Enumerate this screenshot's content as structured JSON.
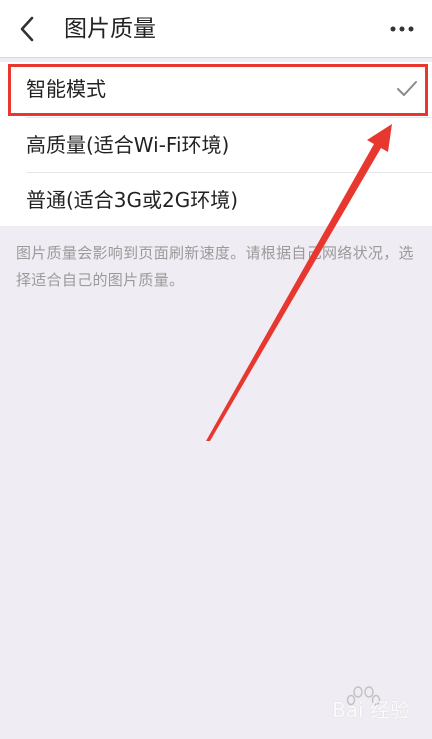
{
  "header": {
    "title": "图片质量",
    "back_icon": "chevron-left-icon",
    "more_icon": "more-dots-icon"
  },
  "options": [
    {
      "label": "智能模式",
      "selected": true
    },
    {
      "label": "高质量(适合Wi-Fi环境)",
      "selected": false
    },
    {
      "label": "普通(适合3G或2G环境)",
      "selected": false
    }
  ],
  "description": "图片质量会影响到页面刷新速度。请根据自己网络状况，选择适合自己的图片质量。",
  "annotation": {
    "highlight_color": "#e8372f",
    "arrow_color": "#e8372f"
  },
  "watermark": {
    "text": "Bai 经验"
  },
  "colors": {
    "background": "#efecf3",
    "surface": "#ffffff",
    "text_primary": "#222222",
    "text_secondary": "#9a9a9a",
    "check": "#8a8a8a"
  }
}
